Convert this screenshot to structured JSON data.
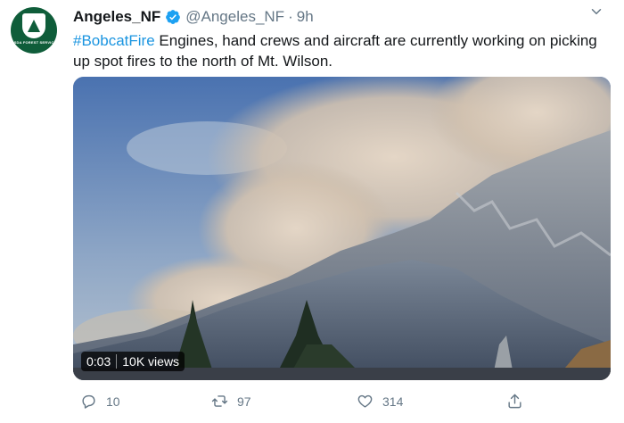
{
  "tweet": {
    "display_name": "Angeles_NF",
    "handle": "@Angeles_NF",
    "separator": "·",
    "time": "9h",
    "avatar_text": "USDA FOREST SERVICE",
    "hashtag": "#BobcatFire",
    "body": " Engines, hand crews and aircraft are currently working on picking up spot fires to the north of Mt. Wilson.",
    "video": {
      "duration": "0:03",
      "views": "10K views"
    },
    "actions": {
      "replies": "10",
      "retweets": "97",
      "likes": "314"
    }
  },
  "colors": {
    "link": "#1b95e0",
    "verified": "#1da1f2",
    "muted": "#657786",
    "avatar": "#0f5d3a"
  },
  "icons": [
    "verified-badge-icon",
    "more-options-icon",
    "reply-icon",
    "retweet-icon",
    "like-icon",
    "share-icon"
  ]
}
